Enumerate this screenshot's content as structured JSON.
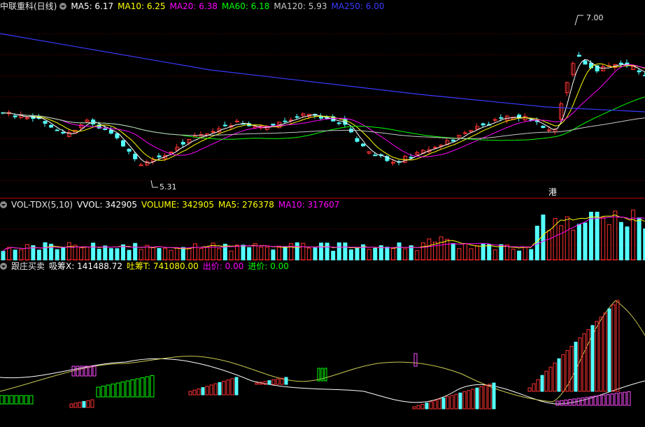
{
  "chart_data": [
    {
      "type": "candlestick",
      "title": "中联重科(日线)",
      "indicators": [
        {
          "name": "MA5",
          "value": "6.17",
          "color": "#ffffff"
        },
        {
          "name": "MA10",
          "value": "6.25",
          "color": "#ffff00"
        },
        {
          "name": "MA20",
          "value": "6.38",
          "color": "#ff00ff"
        },
        {
          "name": "MA60",
          "value": "6.18",
          "color": "#00ff00"
        },
        {
          "name": "MA120",
          "value": "5.93",
          "color": "#c8c8c8"
        },
        {
          "name": "MA250",
          "value": "6.00",
          "color": "#3a3aff"
        }
      ],
      "annotations": {
        "high": "7.00",
        "low": "5.31",
        "tag": "港"
      },
      "ylim": [
        5.2,
        7.15
      ],
      "up_color": "#ff3232",
      "down_color": "#54ffff"
    },
    {
      "type": "bar",
      "title": "VOL-TDX(5,10)",
      "indicators": [
        {
          "name": "VVOL",
          "value": "342905",
          "color": "#ffffff"
        },
        {
          "name": "VOLUME",
          "value": "342905",
          "color": "#ffff00"
        },
        {
          "name": "MA5",
          "value": "276378",
          "color": "#ffff00"
        },
        {
          "name": "MA10",
          "value": "317607",
          "color": "#ff00ff"
        }
      ]
    },
    {
      "type": "bar",
      "title": "跟庄买卖",
      "indicators": [
        {
          "name": "吸筹X",
          "value": "141488.72",
          "color": "#ffffff"
        },
        {
          "name": "吐筹T",
          "value": "741080.00",
          "color": "#ffff00"
        },
        {
          "name": "出价",
          "value": "0.00",
          "color": "#ff00ff"
        },
        {
          "name": "进价",
          "value": "0.00",
          "color": "#00ff00"
        }
      ]
    }
  ]
}
